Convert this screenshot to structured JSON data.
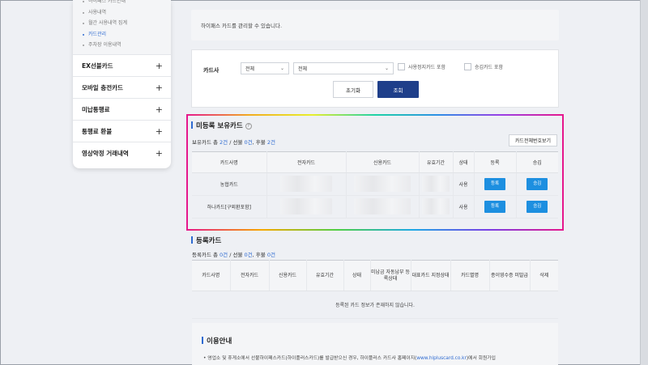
{
  "sidebar": {
    "sub_items": [
      "하이패스 카드안내",
      "사용내역",
      "월간 사용내역 집계",
      "카드관리",
      "주차장 이용내역"
    ],
    "active_sub_index": 3,
    "menu": [
      "EX선불카드",
      "모바일 충전카드",
      "미납통행료",
      "통행료 환불",
      "영상약정 거래내역"
    ],
    "plus": "+"
  },
  "main": {
    "info_text": "하이패스 카드를 관리할 수 있습니다.",
    "search": {
      "label": "카드사",
      "select1": "전체",
      "select2": "전체",
      "chk1": "사용정지카드 포함",
      "chk2": "승김카드 포함",
      "reset": "초기화",
      "submit": "조회"
    },
    "unregistered": {
      "title": "미등록 보유카드",
      "summary_prefix": "보유카드 총 ",
      "total": "2건",
      "mid1": " / 선불 ",
      "prepaid": "0건",
      "mid2": ", 후불 ",
      "postpaid": "2건",
      "view_all": "카드전체번호보기",
      "headers": [
        "카드사명",
        "전자카드",
        "신용카드",
        "유효기간",
        "상태",
        "등록",
        "승김"
      ],
      "rows": [
        {
          "company": "농협카드",
          "status": "사용",
          "register": "등록",
          "transfer": "승김"
        },
        {
          "company": "하나카드[구외환포함]",
          "status": "사용",
          "register": "등록",
          "transfer": "승김"
        }
      ]
    },
    "registered": {
      "title": "등록카드",
      "summary_prefix": "등록카드 총 ",
      "total": "0건",
      "mid1": " / 선불 ",
      "prepaid": "0건",
      "mid2": ", 후불 ",
      "postpaid": "0건",
      "headers": [
        "카드사명",
        "전자카드",
        "신용카드",
        "유효기간",
        "상태",
        "미납금 자동납부 등록상태",
        "대표카드 지정상태",
        "카드별명",
        "종이영수증 미발급",
        "삭제"
      ],
      "empty": "등록된 카드 정보가 존재하지 않습니다."
    },
    "guide": {
      "title": "이용안내",
      "line_before": "• 영업소 및 휴게소에서 선불하이패스카드(하이플러스카드)를 발급받으신 경우, 하이플러스 카드사 홈페이지(",
      "link": "www.hipluscard.co.kr",
      "line_after": ")에서 회원가입"
    }
  }
}
